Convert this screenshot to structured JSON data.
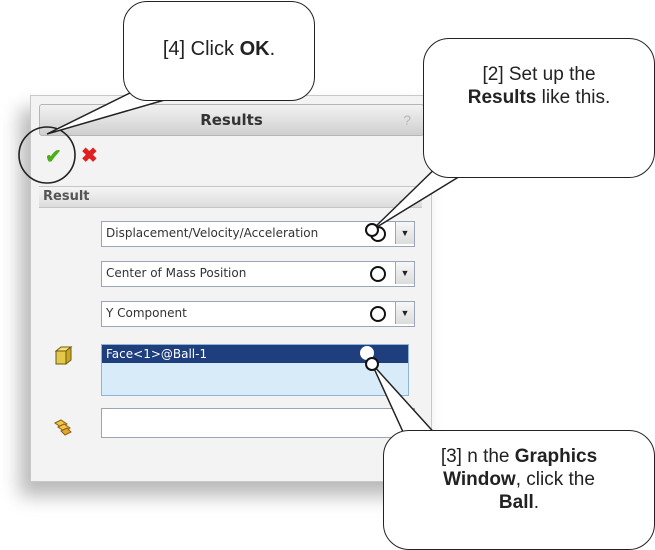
{
  "panel": {
    "title": "Results",
    "help_icon": "?",
    "ok_icon": "✔",
    "cancel_icon": "✖",
    "group_label": "Result",
    "collapse_icon": "︽",
    "combo1": "Displacement/Velocity/Acceleration",
    "combo2": "Center of Mass Position",
    "combo3": "Y Component",
    "face_value": "Face<1>@Ball-1",
    "combo_arrow": "▼"
  },
  "callouts": {
    "c4_prefix": "[4] Click ",
    "c4_bold": "OK",
    "c4_suffix": ".",
    "c2_line1": "[2] Set up the",
    "c2_bold": "Results",
    "c2_suffix": " like this.",
    "c3_prefix": "[3]  n the ",
    "c3_bold1": "Graphics",
    "c3_bold2": "Window",
    "c3_mid": ", click the",
    "c3_bold3": "Ball",
    "c3_suffix": "."
  },
  "colors": {
    "accent": "#1e3e7e",
    "ok": "#4caf1a",
    "cancel": "#e02020"
  },
  "icons": {
    "face_selection": "cube-face-icon",
    "spring": "spring-icon"
  }
}
